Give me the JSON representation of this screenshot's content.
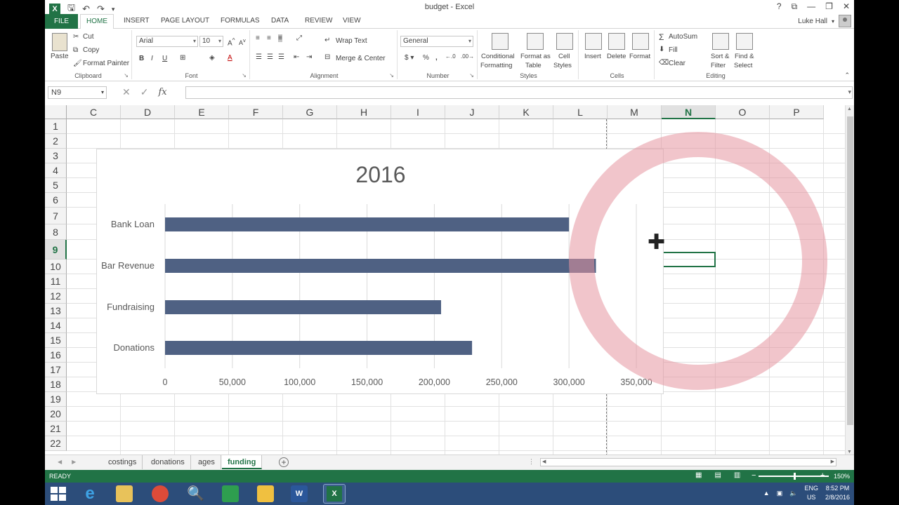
{
  "window": {
    "title": "budget - Excel",
    "controls": [
      "?",
      "⧉",
      "—",
      "❐",
      "✕"
    ]
  },
  "ribbon_tabs": {
    "file": "FILE",
    "home": "HOME",
    "insert": "INSERT",
    "page_layout": "PAGE LAYOUT",
    "formulas": "FORMULAS",
    "data": "DATA",
    "review": "REVIEW",
    "view": "VIEW"
  },
  "user": {
    "name": "Luke Hall"
  },
  "clipboard": {
    "paste": "Paste",
    "cut": "Cut",
    "copy": "Copy",
    "format_painter": "Format Painter",
    "label": "Clipboard"
  },
  "font": {
    "name": "Arial",
    "size": "10",
    "label": "Font"
  },
  "alignment": {
    "wrap_text": "Wrap Text",
    "merge_center": "Merge & Center",
    "label": "Alignment"
  },
  "number": {
    "format": "General",
    "label": "Number"
  },
  "styles": {
    "conditional": "Conditional",
    "formatting": "Formatting",
    "format_as": "Format as",
    "table": "Table",
    "cell": "Cell",
    "cell_styles": "Styles",
    "label": "Styles"
  },
  "cells": {
    "insert": "Insert",
    "delete": "Delete",
    "format": "Format",
    "label": "Cells"
  },
  "editing": {
    "autosum": "AutoSum",
    "fill": "Fill",
    "clear": "Clear",
    "sort": "Sort &",
    "filter": "Filter",
    "find": "Find &",
    "select": "Select",
    "label": "Editing"
  },
  "formula_bar": {
    "name_box": "N9",
    "fx": "fx",
    "value": ""
  },
  "columns": [
    "C",
    "D",
    "E",
    "F",
    "G",
    "H",
    "I",
    "J",
    "K",
    "L",
    "M",
    "N",
    "O",
    "P"
  ],
  "active_column": "N",
  "rows": [
    "1",
    "2",
    "3",
    "4",
    "5",
    "6",
    "7",
    "8",
    "9",
    "10",
    "11",
    "12",
    "13",
    "14",
    "15",
    "16",
    "17",
    "18",
    "19",
    "20",
    "21",
    "22"
  ],
  "active_row": "9",
  "chart_data": {
    "type": "bar",
    "orientation": "horizontal",
    "title": "2016",
    "categories": [
      "Bank Loan",
      "Bar Revenue",
      "Fundraising",
      "Donations"
    ],
    "values": [
      300000,
      320000,
      205000,
      228000
    ],
    "xlim": [
      0,
      350000
    ],
    "x_ticks": [
      "0",
      "50,000",
      "100,000",
      "150,000",
      "200,000",
      "250,000",
      "300,000",
      "350,000"
    ],
    "bar_color": "#4f6183",
    "grid": true,
    "legend": "none",
    "xlabel": "",
    "ylabel": ""
  },
  "sheets": {
    "tabs": [
      "costings",
      "donations",
      "ages",
      "funding"
    ],
    "active": "funding"
  },
  "status": {
    "ready": "READY",
    "zoom": "150%"
  },
  "taskbar": {
    "lang": "ENG",
    "region": "US",
    "time": "8:52 PM",
    "date": "2/8/2016"
  },
  "colors": {
    "excel_green": "#217346",
    "highlight_ring": "#e696a0",
    "taskbar": "#2c4d7a"
  }
}
